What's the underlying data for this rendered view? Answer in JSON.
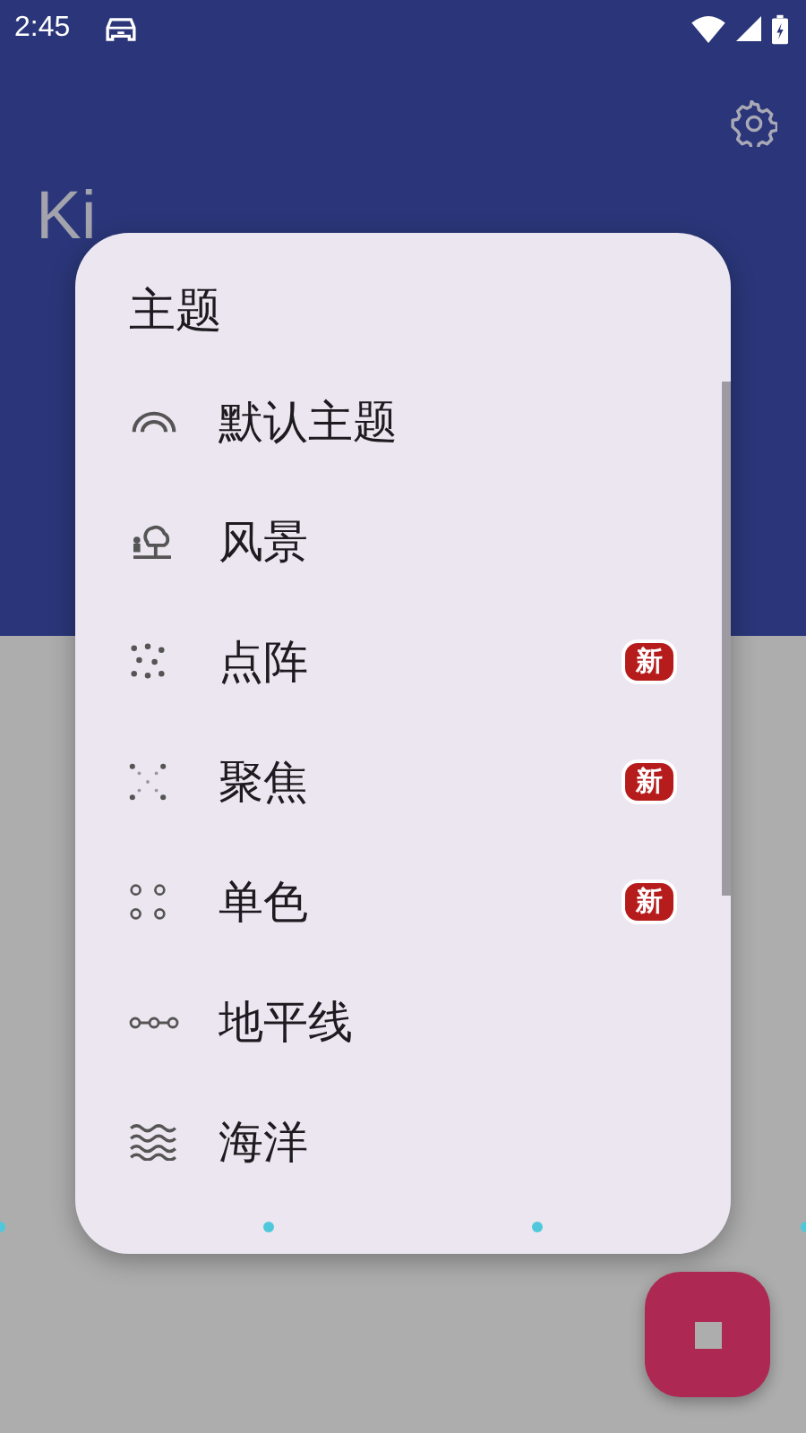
{
  "status_bar": {
    "time": "2:45"
  },
  "header": {
    "title": "Ki"
  },
  "dialog": {
    "title": "主题",
    "items": [
      {
        "label": "默认主题"
      },
      {
        "label": "风景"
      },
      {
        "label": "点阵",
        "badge": "新"
      },
      {
        "label": "聚焦",
        "badge": "新"
      },
      {
        "label": "单色",
        "badge": "新"
      },
      {
        "label": "地平线"
      },
      {
        "label": "海洋"
      }
    ]
  }
}
